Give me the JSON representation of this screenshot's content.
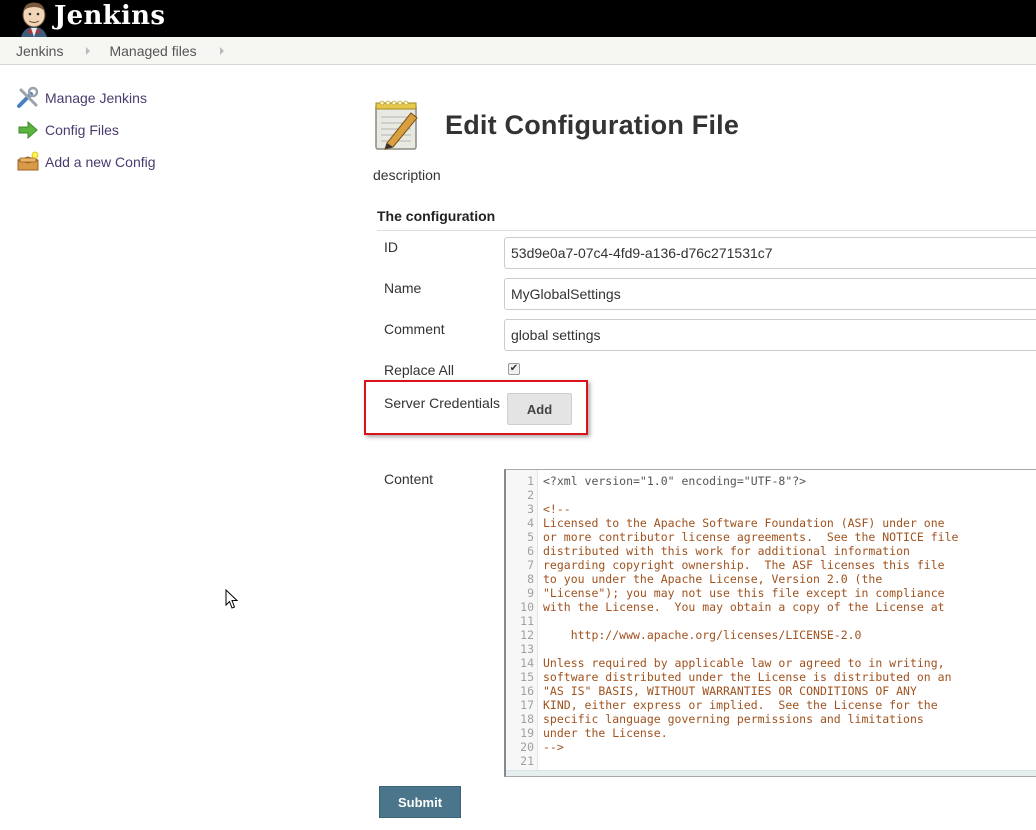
{
  "header": {
    "logo_text": "Jenkins",
    "logo_icon": "jenkins-butler-icon"
  },
  "breadcrumbs": [
    {
      "label": "Jenkins"
    },
    {
      "label": "Managed files"
    }
  ],
  "sidebar": {
    "items": [
      {
        "label": "Manage Jenkins",
        "icon": "tools-icon"
      },
      {
        "label": "Config Files",
        "icon": "green-arrow-icon"
      },
      {
        "label": "Add a new Config",
        "icon": "new-package-icon"
      }
    ]
  },
  "main": {
    "title": "Edit Configuration File",
    "title_icon": "notepad-edit-icon",
    "description": "description",
    "section_title": "The configuration",
    "fields": {
      "id": {
        "label": "ID",
        "value": "53d9e0a7-07c4-4fd9-a136-d76c271531c7"
      },
      "name": {
        "label": "Name",
        "value": "MyGlobalSettings"
      },
      "comment": {
        "label": "Comment",
        "value": "global settings"
      },
      "replace_all": {
        "label": "Replace All",
        "checked": true
      },
      "server_credentials": {
        "label": "Server Credentials",
        "button_label": "Add"
      },
      "content": {
        "label": "Content"
      }
    },
    "content_lines": [
      "<?xml version=\"1.0\" encoding=\"UTF-8\"?>",
      "",
      "<!--",
      "Licensed to the Apache Software Foundation (ASF) under one",
      "or more contributor license agreements.  See the NOTICE file",
      "distributed with this work for additional information",
      "regarding copyright ownership.  The ASF licenses this file",
      "to you under the Apache License, Version 2.0 (the",
      "\"License\"); you may not use this file except in compliance",
      "with the License.  You may obtain a copy of the License at",
      "",
      "    http://www.apache.org/licenses/LICENSE-2.0",
      "",
      "Unless required by applicable law or agreed to in writing,",
      "software distributed under the License is distributed on an",
      "\"AS IS\" BASIS, WITHOUT WARRANTIES OR CONDITIONS OF ANY",
      "KIND, either express or implied.  See the License for the",
      "specific language governing permissions and limitations",
      "under the License.",
      "-->",
      ""
    ],
    "submit_label": "Submit"
  },
  "colors": {
    "header_bg": "#000000",
    "breadcrumb_bg": "#f6f7f2",
    "link": "#4b3a6e",
    "highlight_border": "#d9121b",
    "submit_bg": "#4b758b",
    "comment_text": "#a0521e"
  }
}
